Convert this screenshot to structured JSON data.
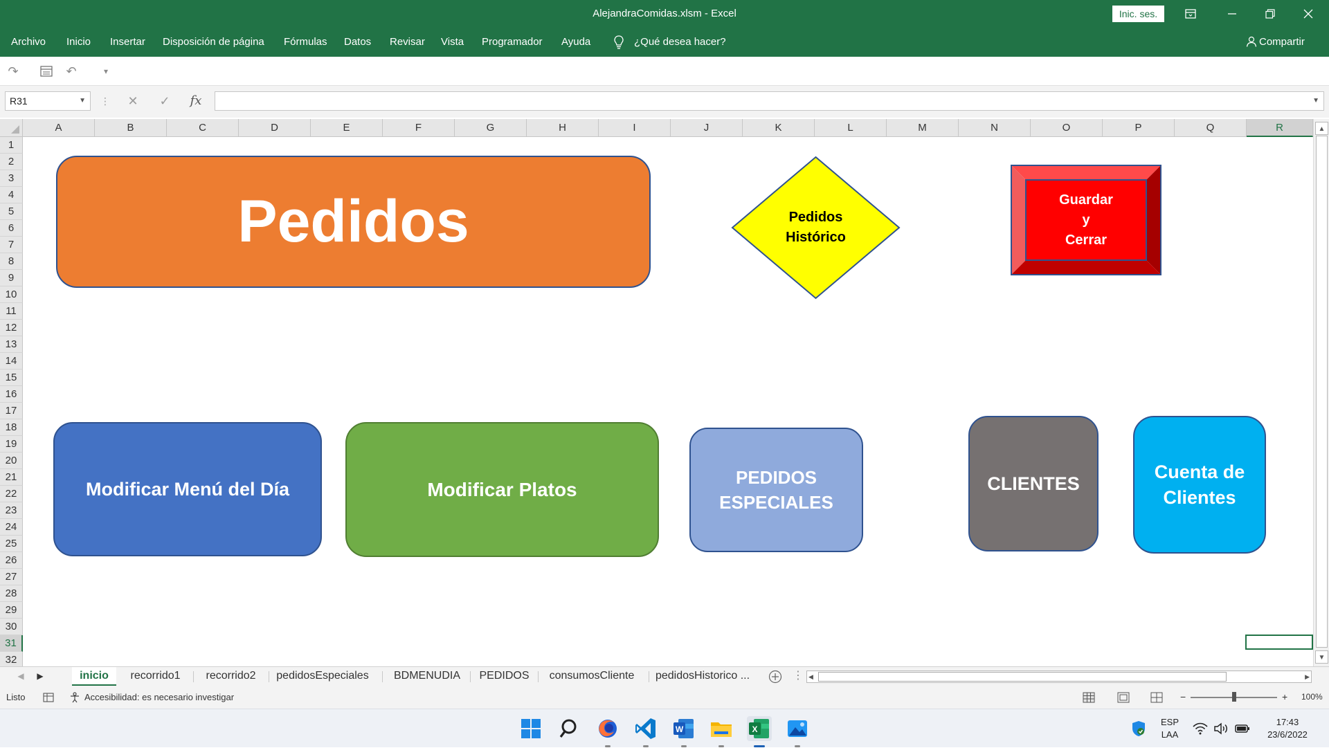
{
  "window": {
    "title": "AlejandraComidas.xlsm  -  Excel",
    "signin_label": "Inic. ses.",
    "controls": [
      "ribbon-display-icon",
      "minimize-icon",
      "restore-icon",
      "close-icon"
    ]
  },
  "ribbon": {
    "tabs": [
      "Archivo",
      "Inicio",
      "Insertar",
      "Disposición de página",
      "Fórmulas",
      "Datos",
      "Revisar",
      "Vista",
      "Programador",
      "Ayuda"
    ],
    "tell_me": "¿Qué desea hacer?",
    "share_label": "Compartir"
  },
  "formula_bar": {
    "name_box": "R31",
    "fx_label": "fx",
    "value": ""
  },
  "grid": {
    "columns": [
      "A",
      "B",
      "C",
      "D",
      "E",
      "F",
      "G",
      "H",
      "I",
      "J",
      "K",
      "L",
      "M",
      "N",
      "O",
      "P",
      "Q",
      "R"
    ],
    "rows": [
      "1",
      "2",
      "3",
      "4",
      "5",
      "6",
      "7",
      "8",
      "9",
      "10",
      "11",
      "12",
      "13",
      "14",
      "15",
      "16",
      "17",
      "18",
      "19",
      "20",
      "21",
      "22",
      "23",
      "24",
      "25",
      "26",
      "27",
      "28",
      "29",
      "30",
      "31",
      "32"
    ],
    "active_column": "R",
    "active_row": "31"
  },
  "shapes": {
    "pedidos": {
      "label": "Pedidos",
      "color": "#ED7D31"
    },
    "pedidos_historico": {
      "line1": "Pedidos",
      "line2": "Histórico",
      "color": "#FFFF00"
    },
    "guardar_cerrar": {
      "line1": "Guardar",
      "line2": "y",
      "line3": "Cerrar",
      "color": "#FF0000"
    },
    "modificar_menu": {
      "label": "Modificar Menú del Día",
      "color": "#4472C4"
    },
    "modificar_platos": {
      "label": "Modificar Platos",
      "color": "#70AD47"
    },
    "pedidos_especiales": {
      "line1": "PEDIDOS",
      "line2": "ESPECIALES",
      "color": "#8FAADC"
    },
    "clientes": {
      "label": "CLIENTES",
      "color": "#767171"
    },
    "cuenta_clientes": {
      "line1": "Cuenta de",
      "line2": "Clientes",
      "color": "#00B0F0"
    }
  },
  "sheets": {
    "tabs": [
      "inicio",
      "recorrido1",
      "recorrido2",
      "pedidosEspeciales",
      "BDMENUDIA",
      "PEDIDOS",
      "consumosCliente",
      "pedidosHistorico ..."
    ],
    "active": "inicio"
  },
  "status": {
    "ready": "Listo",
    "accessibility": "Accesibilidad: es necesario investigar",
    "zoom": "100%",
    "zoom_minus": "−",
    "zoom_plus": "+"
  },
  "taskbar": {
    "apps": [
      "windows-start-icon",
      "search-icon",
      "firefox-icon",
      "vscode-icon",
      "word-icon",
      "file-explorer-icon",
      "excel-icon",
      "photos-icon"
    ],
    "lang_line1": "ESP",
    "lang_line2": "LAA",
    "time": "17:43",
    "date": "23/6/2022"
  }
}
